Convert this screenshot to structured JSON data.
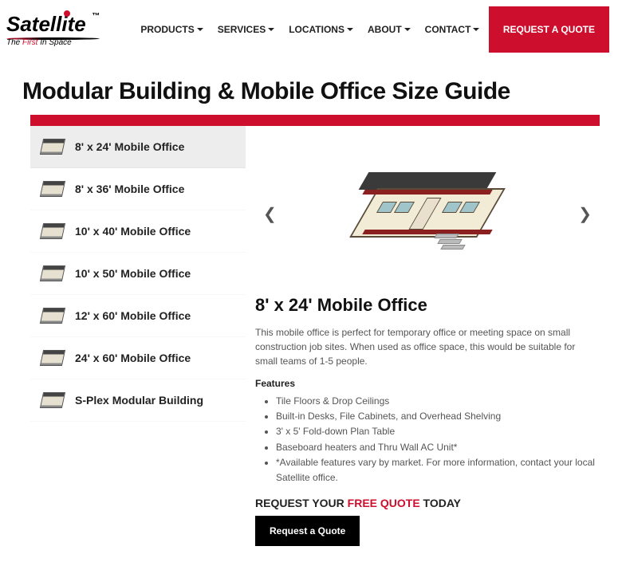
{
  "brand": {
    "name": "Satellite",
    "tagline_pre": "The ",
    "tagline_em": "First",
    "tagline_post": " In Space"
  },
  "nav": {
    "items": [
      {
        "label": "PRODUCTS"
      },
      {
        "label": "SERVICES"
      },
      {
        "label": "LOCATIONS"
      },
      {
        "label": "ABOUT"
      },
      {
        "label": "CONTACT"
      }
    ],
    "quote": "REQUEST A QUOTE"
  },
  "page": {
    "title": "Modular Building & Mobile Office Size Guide"
  },
  "tabs": [
    {
      "label": "8' x 24' Mobile Office"
    },
    {
      "label": "8' x 36' Mobile Office"
    },
    {
      "label": "10' x 40' Mobile Office"
    },
    {
      "label": "10' x 50' Mobile Office"
    },
    {
      "label": "12' x 60' Mobile Office"
    },
    {
      "label": "24' x 60' Mobile Office"
    },
    {
      "label": "S-Plex Modular Building"
    }
  ],
  "active_tab": 0,
  "detail": {
    "title": "8' x 24' Mobile Office",
    "description": "This mobile office is perfect for temporary office or meeting space on small construction job sites. When used as office space, this would be suitable for small teams of 1-5 people.",
    "features_label": "Features",
    "features": [
      "Tile Floors & Drop Ceilings",
      "Built-in Desks, File Cabinets, and Overhead Shelving",
      "3' x 5' Fold-down Plan Table",
      "Baseboard heaters and Thru Wall AC Unit*",
      "*Available features vary by market. For more information, contact your local Satellite office."
    ],
    "cta_pre": "REQUEST YOUR ",
    "cta_em": "FREE QUOTE",
    "cta_post": " TODAY",
    "cta_button": "Request a Quote"
  }
}
